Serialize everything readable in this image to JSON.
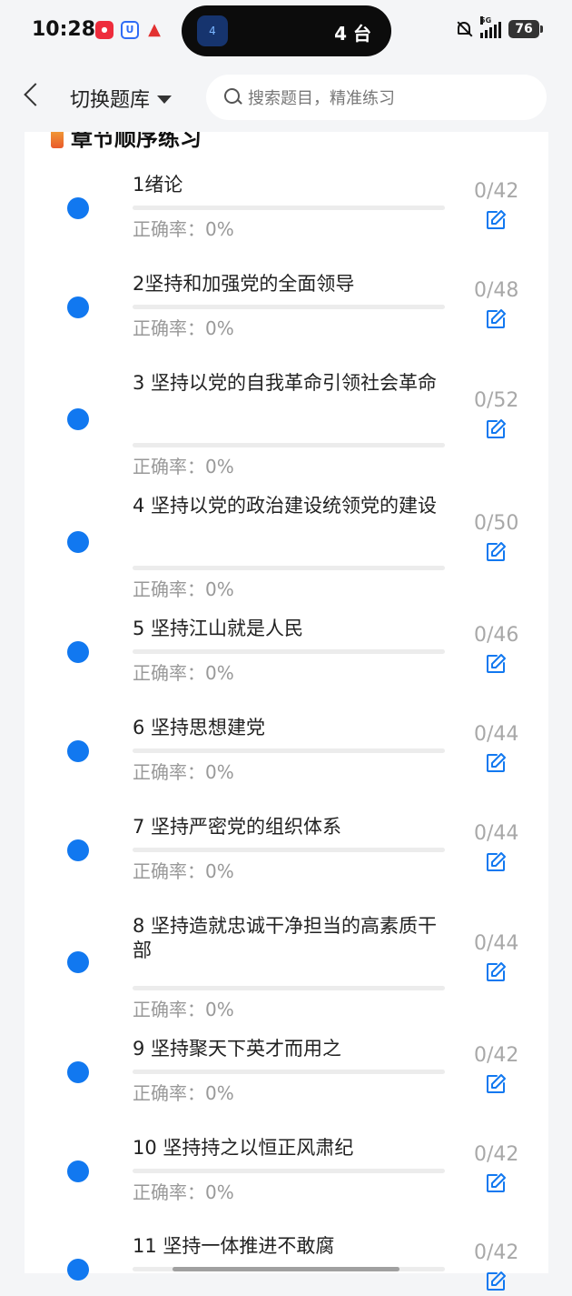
{
  "status_bar": {
    "time": "10:28",
    "island_badge": "4",
    "island_text": "4 台",
    "network": "5G",
    "battery": "76"
  },
  "nav": {
    "switch_label": "切换题库",
    "search_placeholder": "搜索题目，精准练习"
  },
  "section": {
    "title": "章节顺序练习"
  },
  "chapters": [
    {
      "title": "1绪论",
      "rate": "正确率：0%",
      "count": "0/42",
      "progress": 0
    },
    {
      "title": "2坚持和加强党的全面领导",
      "rate": "正确率：0%",
      "count": "0/48",
      "progress": 0
    },
    {
      "title": "3 坚持以党的自我革命引领社会革命",
      "rate": "正确率：0%",
      "count": "0/52",
      "progress": 0
    },
    {
      "title": "4 坚持以党的政治建设统领党的建设",
      "rate": "正确率：0%",
      "count": "0/50",
      "progress": 0
    },
    {
      "title": "5 坚持江山就是人民",
      "rate": "正确率：0%",
      "count": "0/46",
      "progress": 0
    },
    {
      "title": "6 坚持思想建党",
      "rate": "正确率：0%",
      "count": "0/44",
      "progress": 0
    },
    {
      "title": "7 坚持严密党的组织体系",
      "rate": "正确率：0%",
      "count": "0/44",
      "progress": 0
    },
    {
      "title": "8 坚持造就忠诚干净担当的高素质干部",
      "rate": "正确率：0%",
      "count": "0/44",
      "progress": 0
    },
    {
      "title": "9 坚持聚天下英才而用之",
      "rate": "正确率：0%",
      "count": "0/42",
      "progress": 0
    },
    {
      "title": "10 坚持持之以恒正风肃纪",
      "rate": "正确率：0%",
      "count": "0/42",
      "progress": 0
    },
    {
      "title": "11 坚持一体推进不敢腐",
      "rate": "",
      "count": "0/42",
      "progress": 0
    }
  ],
  "colors": {
    "accent": "#1178f0",
    "muted": "#999999"
  }
}
